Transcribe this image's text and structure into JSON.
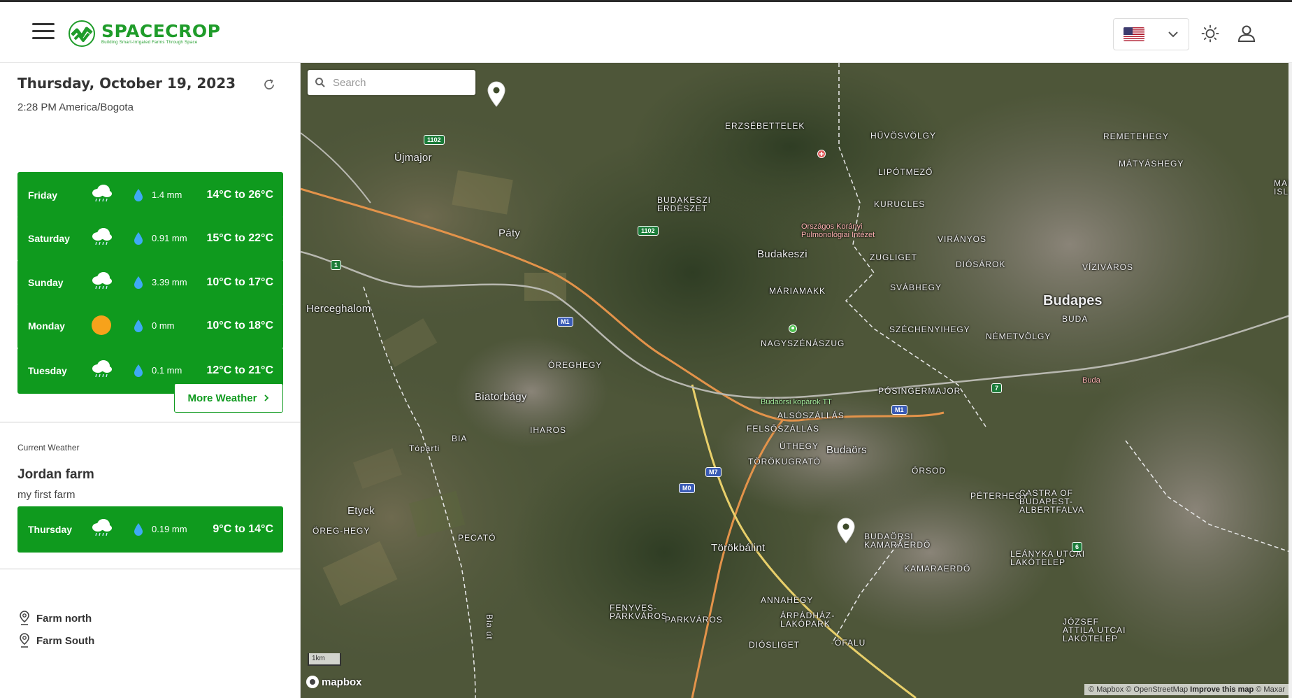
{
  "header": {
    "brand_name": "SPACECROP",
    "brand_tagline": "Building Smart-Irrigated Farms Through Space",
    "language_flag": "us-flag-icon",
    "icons": [
      "menu-icon",
      "chevron-down-icon",
      "theme-sun-icon",
      "user-icon"
    ]
  },
  "sidebar": {
    "date": "Thursday, October 19, 2023",
    "time": "2:28 PM America/Bogota",
    "forecast": [
      {
        "day": "Friday",
        "icon": "rain-cloud-icon",
        "rain": "1.4 mm",
        "temp": "14°C to 26°C"
      },
      {
        "day": "Saturday",
        "icon": "rain-cloud-icon",
        "rain": "0.91 mm",
        "temp": "15°C to 22°C"
      },
      {
        "day": "Sunday",
        "icon": "rain-cloud-icon",
        "rain": "3.39 mm",
        "temp": "10°C to 17°C"
      },
      {
        "day": "Monday",
        "icon": "sun-icon",
        "rain": "0 mm",
        "temp": "10°C to 18°C"
      },
      {
        "day": "Tuesday",
        "icon": "rain-cloud-icon",
        "rain": "0.1 mm",
        "temp": "12°C to 21°C"
      }
    ],
    "more_weather_label": "More Weather",
    "current_weather_label": "Current Weather",
    "farm_name": "Jordan farm",
    "farm_description": "my first farm",
    "current": {
      "day": "Thursday",
      "icon": "rain-cloud-icon",
      "rain": "0.19 mm",
      "temp": "9°C  to  14°C"
    },
    "farms": [
      "Farm north",
      "Farm South"
    ]
  },
  "map": {
    "search_placeholder": "Search",
    "scale_label": "1km",
    "provider": "mapbox",
    "attribution_prefix": "© Mapbox © OpenStreetMap ",
    "attribution_link": "Improve this map",
    "attribution_suffix": " © Maxar",
    "labels": {
      "erzsebetelek": "ERZSÉBETTELEK",
      "hu": "HŰVÖSVÖLGY",
      "remetehegy": "REMETEHEGY",
      "ujmajor": "Újmajor",
      "matyashegy": "MÁTYÁSHEGY",
      "lipotmezo": "LIPÓTMEZŐ",
      "margit": "MARG\nISLA",
      "budakeszi_erdeszet": "BUDAKESZI\nERDÉSZET",
      "kurucles": "KURUCLES",
      "orszagos": "Országos Korányi\nPulmonológiai Intézet",
      "viranyos": "VIRÁNYOS",
      "paty": "Páty",
      "budakeszi": "Budakeszi",
      "zugliget": "ZUGLIGET",
      "diosarok": "DIÓSÁROK",
      "vizivaros": "VÍZIVÁROS",
      "svabhegy": "SVÁBHEGY",
      "mariamakk": "MÁRIAMAKK",
      "budapest": "Budapes",
      "buda": "BUDA",
      "herceghalom": "Herceghalom",
      "szechenyihegy": "SZÉCHENYIHEGY",
      "nemetvolgy": "NÉMETVÖLGY",
      "nagyszenaszug": "NAGYSZÉNÁSZUG",
      "oreghegy": "ÓREGHEGY",
      "budaorsi_koparok": "Budaörsi kopárok TT",
      "posingermajor": "PÓSINGERMAJOR",
      "buda_small": "Buda",
      "biatorbagy": "Biatorbágy",
      "alsoszallas": "ALSÓSZÁLLÁS",
      "felsoszallas": "FELSŐSZÁLLÁS",
      "iharos": "IHAROS",
      "bia": "BIA",
      "uthegy": "ÚTHEGY",
      "budaors": "Budaörs",
      "toparti": "Tóparti",
      "torokugrato": "TÖRÖKUGRATÓ",
      "orsod": "ÖRSOD",
      "castra": "CASTRA OF\nBUDAPEST-\nALBERTFALVA",
      "peterhegy": "PÉTERHEGY",
      "etyek": "Etyek",
      "oreg_hegy": "ÖREG-HEGY",
      "pecato": "PECATÓ",
      "budaorsi_kamaraerdo": "BUDAÖRSI\nKAMARAERDŐ",
      "torokbalint": "Törökbálint",
      "leanyka": "LEÁNYKA UTCAI\nLAKÓTELEP",
      "kamaraerdo": "KAMARAERDŐ",
      "annahegy": "ANNAHEGY",
      "fenyves": "FENYVES-\nPARKVÁROS",
      "parkvaros": "PARKVÁROS",
      "arpadhaz": "ÁRPÁDHÁZ-\nLAKÓPARK",
      "jozsef": "JÓZSEF\nATTILA UTCAI\nLAKÓTELEP",
      "diosliget": "DIÓSLIGET",
      "ofalu": "ÓFALU",
      "biaut": "Bia út"
    },
    "road_badges": [
      "1102",
      "1102",
      "1",
      "M1",
      "M1",
      "M7",
      "M0",
      "7",
      "6"
    ]
  }
}
